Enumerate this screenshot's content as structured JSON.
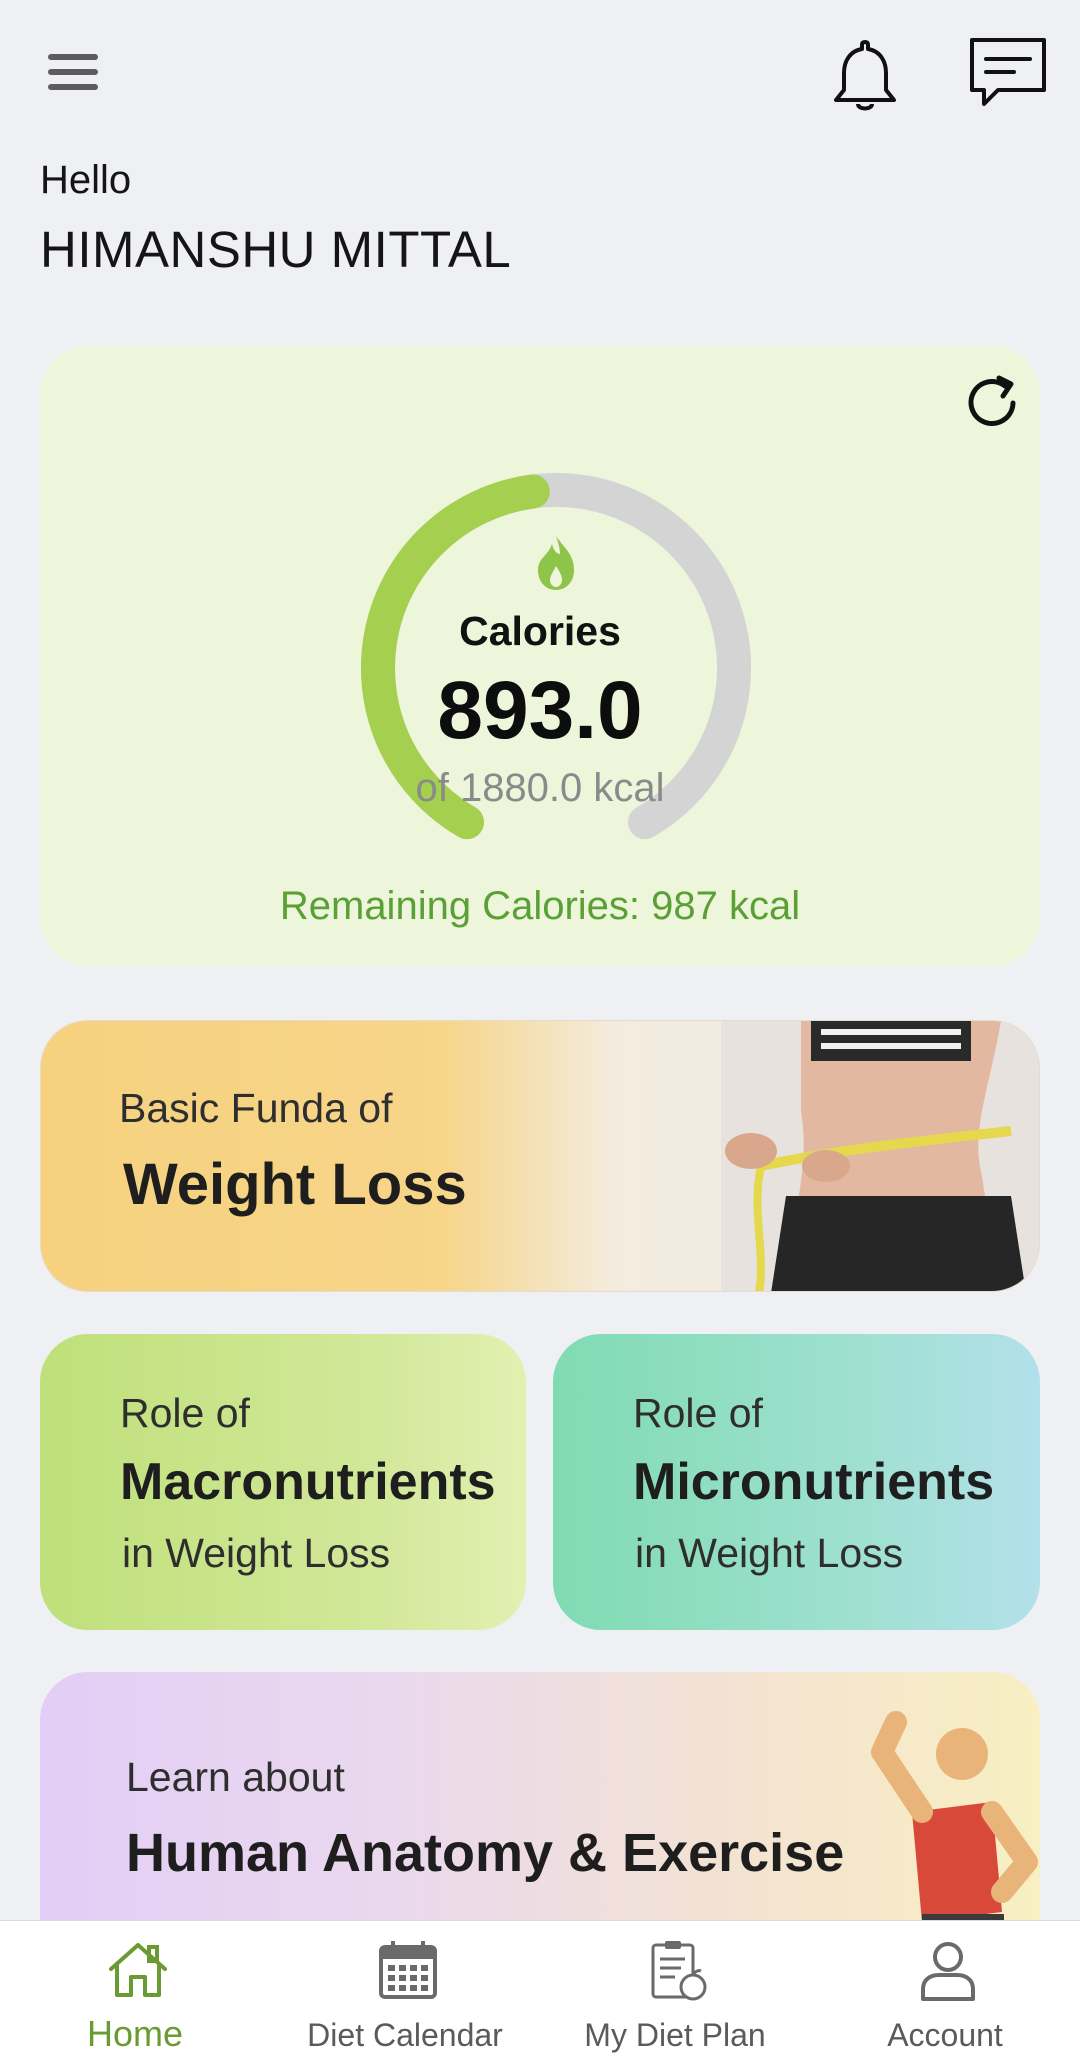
{
  "header": {
    "greeting": "Hello",
    "user_name": "HIMANSHU MITTAL",
    "icons": [
      "menu-icon",
      "bell-icon",
      "chat-icon"
    ]
  },
  "calories": {
    "label": "Calories",
    "consumed": "893.0",
    "total_text": "of 1880.0 kcal",
    "remaining_text": "Remaining Calories: 987 kcal",
    "progress_fraction": 0.475,
    "accent_color": "#a5cf4f",
    "track_color": "#d4d4d4",
    "icon": "flame-icon"
  },
  "banners": {
    "weight_loss": {
      "line1": "Basic Funda of",
      "line2": "Weight Loss"
    },
    "macros": {
      "line1": "Role of",
      "line2": "Macronutrients",
      "line3": "in Weight Loss"
    },
    "micros": {
      "line1": "Role of",
      "line2": "Micronutrients",
      "line3": "in Weight Loss"
    },
    "anatomy": {
      "line1": "Learn about",
      "line2": "Human Anatomy & Exercise"
    }
  },
  "bottom_nav": {
    "items": [
      {
        "label": "Home",
        "icon": "home-icon",
        "active": true
      },
      {
        "label": "Diet Calendar",
        "icon": "calendar-icon",
        "active": false
      },
      {
        "label": "My Diet Plan",
        "icon": "diet-plan-icon",
        "active": false
      },
      {
        "label": "Account",
        "icon": "account-icon",
        "active": false
      }
    ],
    "active_color": "#6a9b33"
  }
}
